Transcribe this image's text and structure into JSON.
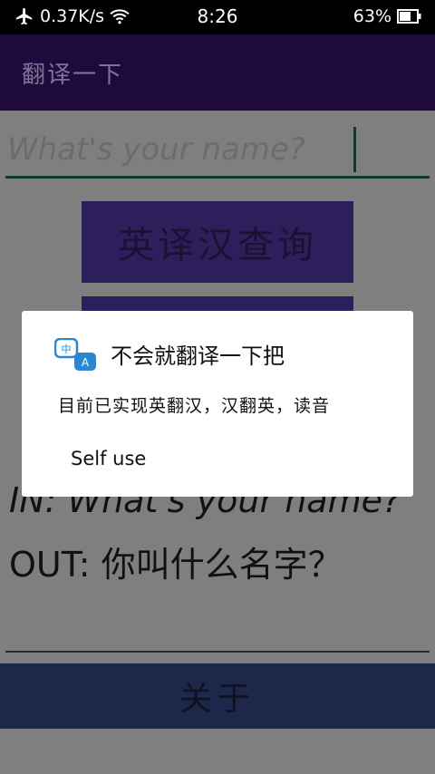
{
  "status_bar": {
    "network_speed": "0.37K/s",
    "time": "8:26",
    "battery_percent": "63%"
  },
  "app_bar": {
    "title": "翻译一下"
  },
  "input": {
    "placeholder": "What's your name?",
    "value": ""
  },
  "buttons": {
    "query": "英译汉查询",
    "second": "",
    "about": "关于"
  },
  "io": {
    "in_text": "IN: What's your name?",
    "out_text": "OUT: 你叫什么名字？"
  },
  "dialog": {
    "title": "不会就翻译一下把",
    "message": "目前已实现英翻汉，汉翻英，读音",
    "footer": "Self use"
  },
  "colors": {
    "app_bar": "#4a0aa0",
    "button": "#5b4aa8",
    "about_bar": "#34458f",
    "underline": "#1a6b5e"
  },
  "icons": {
    "airplane": "airplane-icon",
    "wifi": "wifi-icon",
    "battery": "battery-icon",
    "translate": "translate-icon"
  }
}
